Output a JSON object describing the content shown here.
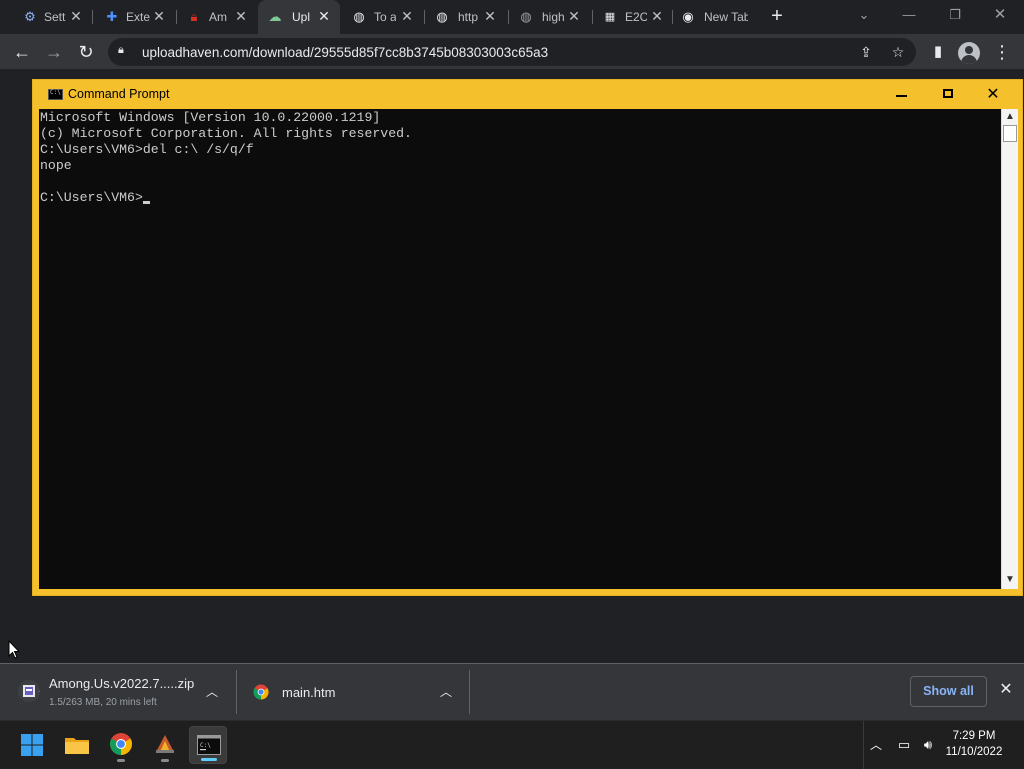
{
  "browser": {
    "tabs": [
      {
        "title": "Setti",
        "icon": "gear-icon",
        "icon_color": "#8ab4f8"
      },
      {
        "title": "Exte",
        "icon": "puzzle-icon",
        "icon_color": "#4d90fe"
      },
      {
        "title": "Am",
        "icon": "lock-icon",
        "icon_color": "#d93025"
      },
      {
        "title": "Upl",
        "icon": "cloud-icon",
        "icon_color": "#81c995",
        "active": true
      },
      {
        "title": "To a",
        "icon": "globe-icon",
        "icon_color": "#e8eaed"
      },
      {
        "title": "http",
        "icon": "globe-icon",
        "icon_color": "#e8eaed"
      },
      {
        "title": "high",
        "icon": "globe-icon",
        "icon_color": "#9aa0a6"
      },
      {
        "title": "E2C",
        "icon": "calculator-icon",
        "icon_color": "#e8eaed"
      },
      {
        "title": "New Tab",
        "icon": "chrome-icon",
        "icon_color": "#e8eaed"
      }
    ],
    "url": "uploadhaven.com/download/29555d85f7cc8b3745b08303003c65a3"
  },
  "cmd": {
    "title": "Command Prompt",
    "lines": [
      "Microsoft Windows [Version 10.0.22000.1219]",
      "(c) Microsoft Corporation. All rights reserved.",
      "C:\\Users\\VM6>del c:\\ /s/q/f",
      "nope",
      "",
      "C:\\Users\\VM6>"
    ]
  },
  "downloads": {
    "items": [
      {
        "name": "Among.Us.v2022.7.....zip",
        "status": "1.5/263 MB, 20 mins left",
        "progress_fraction": 0.006
      },
      {
        "name": "main.htm",
        "status": ""
      }
    ],
    "show_all_label": "Show all"
  },
  "taskbar": {
    "apps": [
      "windows-start-icon",
      "file-explorer-icon",
      "chrome-icon",
      "app-icon",
      "terminal-icon"
    ],
    "time": "7:29 PM",
    "date": "11/10/2022"
  },
  "colors": {
    "cmd_frame": "#f4c02c",
    "console_bg": "#0c0c0c",
    "accent_blue": "#8ab4f8"
  }
}
